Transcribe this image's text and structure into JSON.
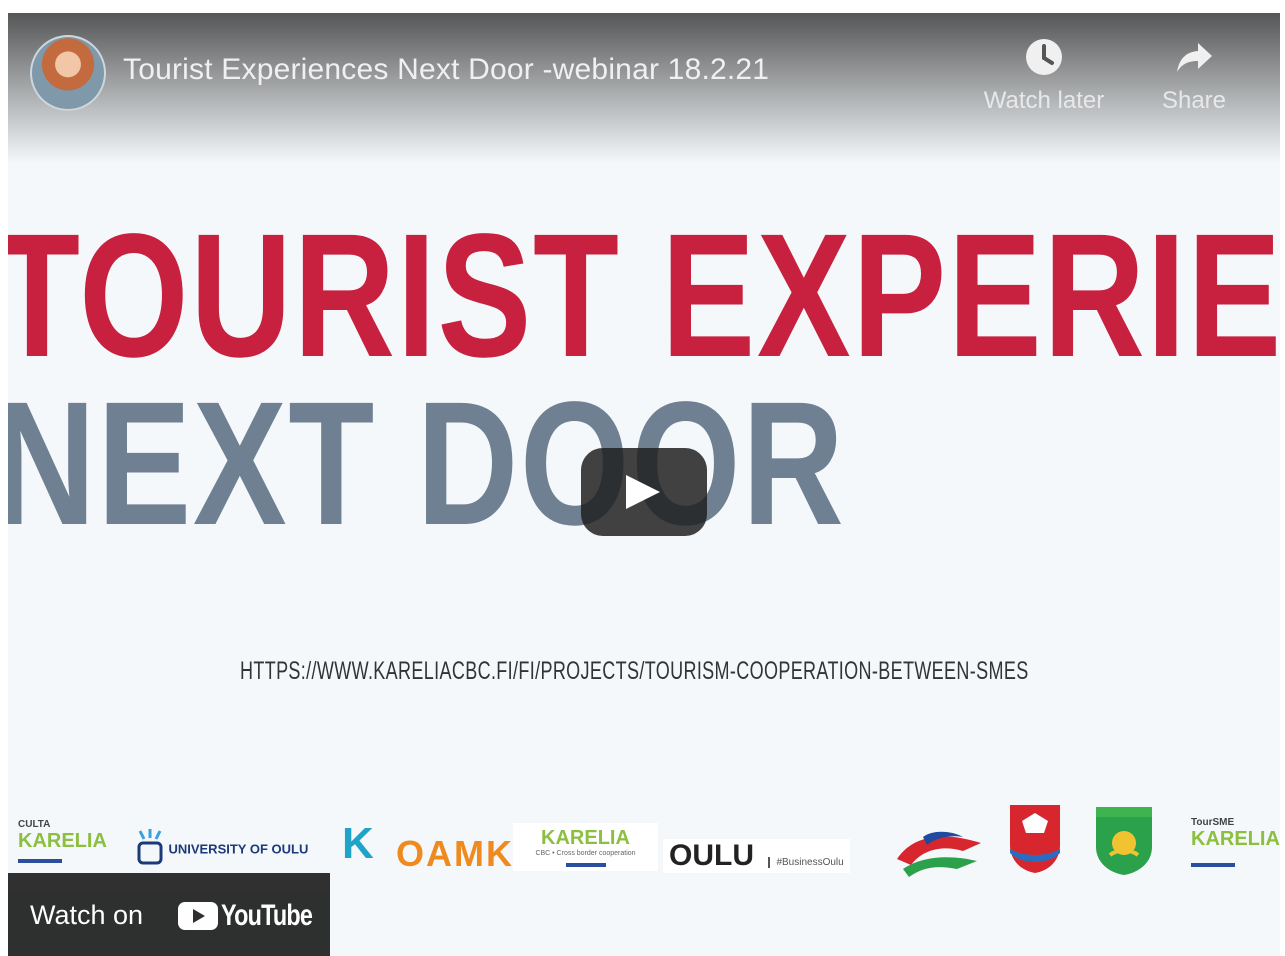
{
  "video": {
    "title": "Tourist Experiences Next Door -webinar 18.2.21",
    "actions": {
      "watch_later": "Watch later",
      "share": "Share"
    }
  },
  "slide": {
    "headline": "TOURIST EXPERIENCES",
    "subheadline": "NEXT DOOR",
    "url": "HTTPS://WWW.KARELIACBC.FI/FI/PROJECTS/TOURISM-COOPERATION-BETWEEN-SMES"
  },
  "logos": {
    "culta_small": "CULTA",
    "culta": "KARELIA",
    "university": "UNIVERSITY OF OULU",
    "k": "K",
    "oamk": "OAMK",
    "karelia_cbc": "KARELIA",
    "karelia_cbc_sub": "CBC • Cross border cooperation",
    "oulu": "OULU",
    "business_oulu": "#BusinessOulu",
    "toursme_small": "TourSME",
    "toursme": "KARELIA"
  },
  "footer": {
    "watch_on": "Watch on",
    "youtube": "YouTube"
  },
  "colors": {
    "headline": "#c8203f",
    "subheadline": "#6e8091",
    "background": "#f4f8fb"
  }
}
